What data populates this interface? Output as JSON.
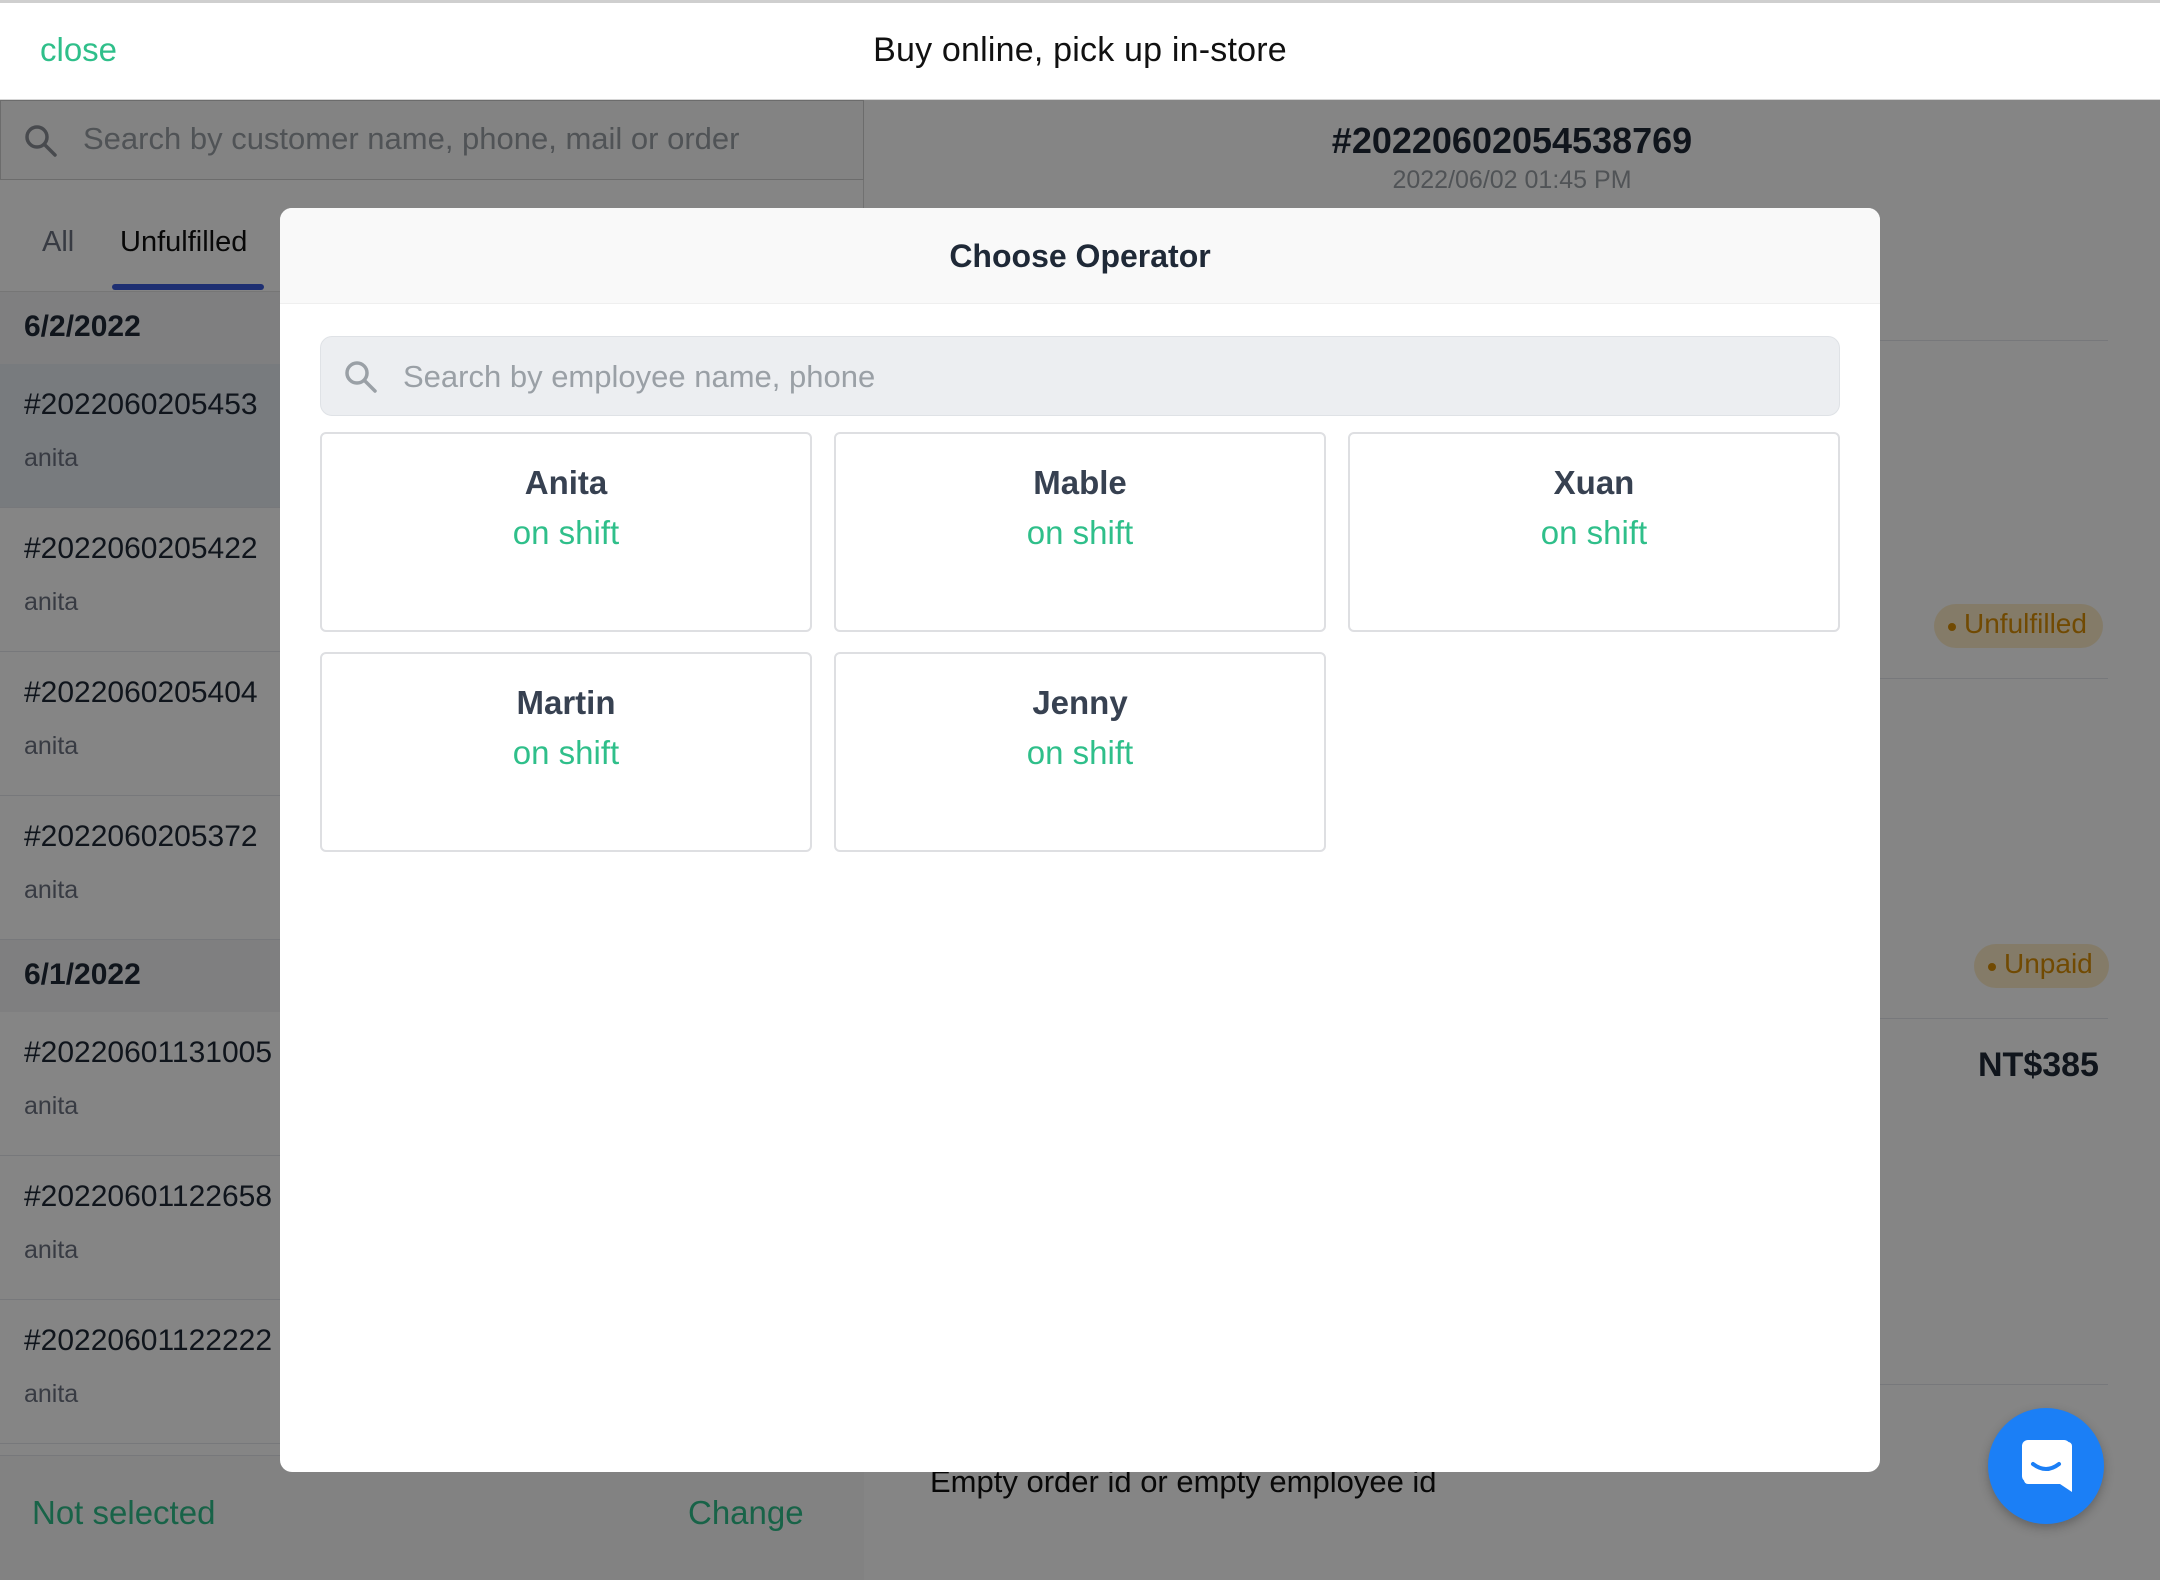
{
  "header": {
    "close_label": "close",
    "title": "Buy online, pick up in-store"
  },
  "orders_panel": {
    "search_placeholder": "Search by customer name, phone, mail or order",
    "tabs": [
      {
        "label": "All"
      },
      {
        "label": "Unfulfilled"
      }
    ],
    "groups": [
      {
        "date": "6/2/2022",
        "orders": [
          {
            "id": "#2022060205453",
            "customer": "anita"
          },
          {
            "id": "#2022060205422",
            "customer": "anita"
          },
          {
            "id": "#2022060205404",
            "customer": "anita"
          },
          {
            "id": "#2022060205372",
            "customer": "anita"
          }
        ]
      },
      {
        "date": "6/1/2022",
        "orders": [
          {
            "id": "#20220601131005",
            "customer": "anita"
          },
          {
            "id": "#20220601122658",
            "customer": "anita"
          },
          {
            "id": "#20220601122222",
            "customer": "anita"
          }
        ]
      }
    ],
    "footer": {
      "operator_status": "Not selected",
      "change_label": "Change"
    }
  },
  "order_detail": {
    "order_id": "#20220602054538769",
    "order_datetime": "2022/06/02 01:45 PM",
    "fulfillment_badge": "Unfulfilled",
    "payment_badge": "Unpaid",
    "total": "NT$385",
    "error_message": "Empty order id or empty employee id"
  },
  "operator_modal": {
    "title": "Choose Operator",
    "search_placeholder": "Search by employee name, phone",
    "employees": [
      {
        "name": "Anita",
        "status": "on shift"
      },
      {
        "name": "Mable",
        "status": "on shift"
      },
      {
        "name": "Xuan",
        "status": "on shift"
      },
      {
        "name": "Martin",
        "status": "on shift"
      },
      {
        "name": "Jenny",
        "status": "on shift"
      }
    ]
  },
  "colors": {
    "accent_green": "#2fbf8a",
    "tab_underline": "#3b5bdb",
    "badge_orange": "#d98e04",
    "chat_blue": "#1b7ff6"
  },
  "icons": {
    "search": "search-icon",
    "chat": "chat-icon"
  }
}
